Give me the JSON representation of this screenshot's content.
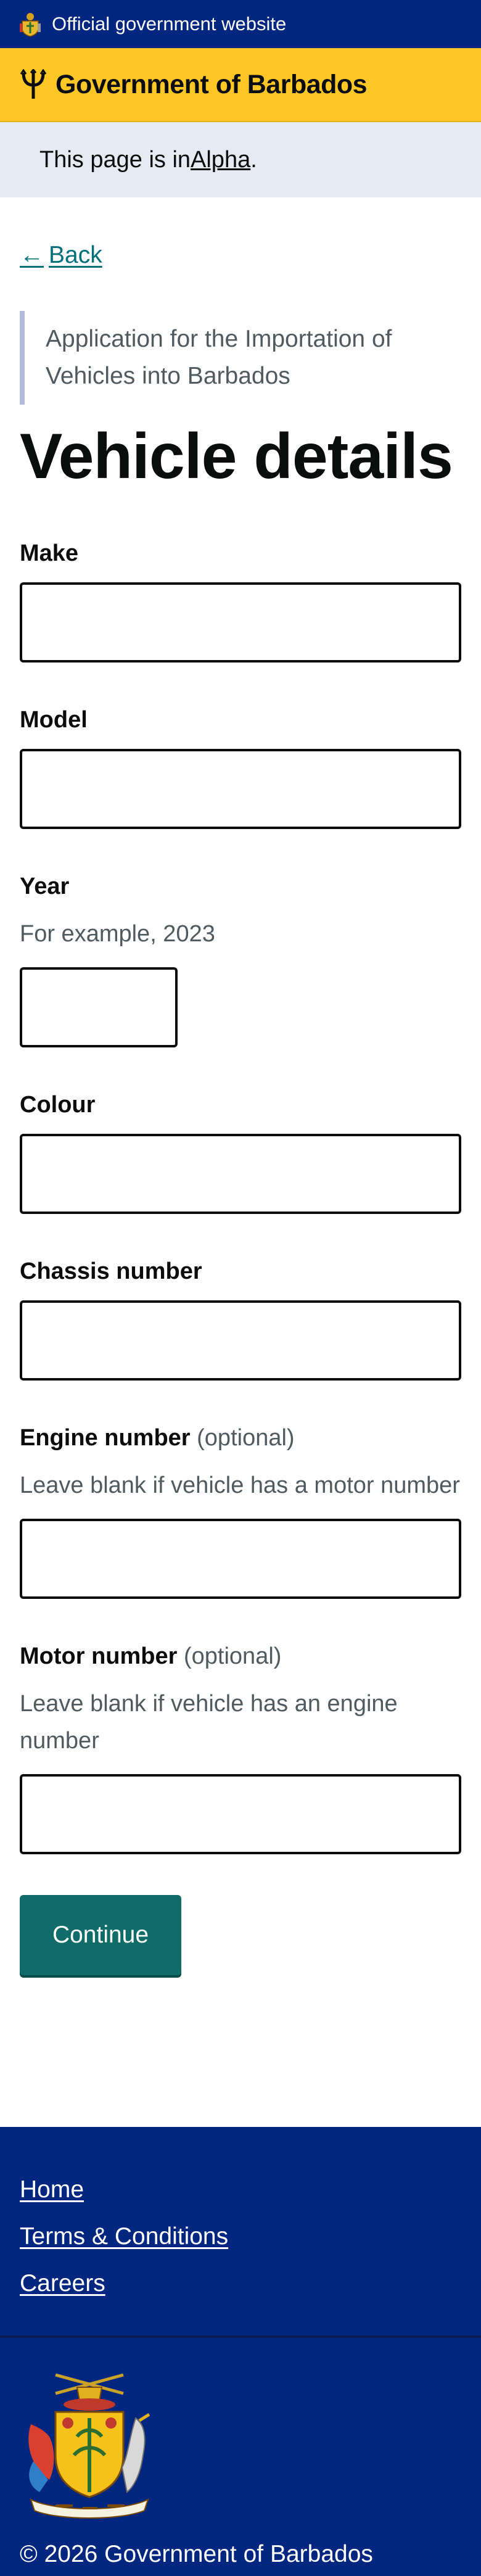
{
  "top_strip": {
    "text": "Official government website"
  },
  "gov_bar": {
    "name": "Government of Barbados"
  },
  "phase_banner": {
    "prefix": "This page is in ",
    "link": "Alpha",
    "suffix": "."
  },
  "back": {
    "arrow": "←",
    "label": "Back"
  },
  "caption": "Application for the Importation of Vehicles into Barbados",
  "heading": "Vehicle details",
  "fields": {
    "make": {
      "label": "Make",
      "value": ""
    },
    "model": {
      "label": "Model",
      "value": ""
    },
    "year": {
      "label": "Year",
      "hint": "For example, 2023",
      "value": ""
    },
    "colour": {
      "label": "Colour",
      "value": ""
    },
    "chassis": {
      "label": "Chassis number",
      "value": ""
    },
    "engine": {
      "label": "Engine number",
      "optional": "(optional)",
      "hint": "Leave blank if vehicle has a motor number",
      "value": ""
    },
    "motor": {
      "label": "Motor number",
      "optional": "(optional)",
      "hint": "Leave blank if vehicle has an engine number",
      "value": ""
    }
  },
  "continue_label": "Continue",
  "footer": {
    "links": [
      "Home",
      "Terms & Conditions",
      "Careers"
    ],
    "copyright": "© 2026 Government of Barbados",
    "coat_of_arms_motto": "PRIDE AND INDUSTRY"
  },
  "colors": {
    "navy": "#00267f",
    "gold": "#ffc726",
    "phase_bg": "#e6eaf2",
    "link_teal": "#00707a",
    "button": "#0f6c68"
  },
  "icons": [
    "crest-icon",
    "trident-icon",
    "coat-of-arms-icon"
  ]
}
